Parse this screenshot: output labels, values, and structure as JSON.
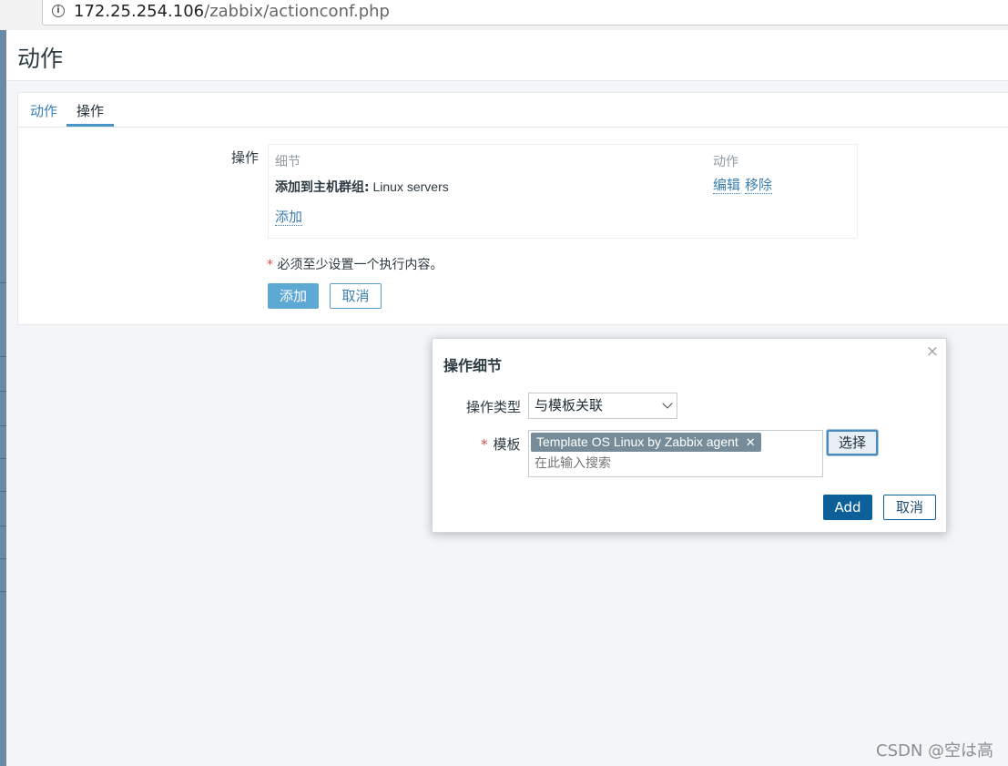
{
  "browser": {
    "url_host": "172.25.254.106",
    "url_path": "/zabbix/actionconf.php"
  },
  "page": {
    "title": "动作"
  },
  "tabs": [
    {
      "label": "动作"
    },
    {
      "label": "操作"
    }
  ],
  "operations": {
    "label": "操作",
    "col_detail": "细节",
    "col_action": "动作",
    "row": {
      "detail_bold": "添加到主机群组:",
      "detail_value": "Linux servers",
      "edit_label": "编辑",
      "remove_label": "移除"
    },
    "add_link": "添加"
  },
  "required_note": {
    "star": "*",
    "text": "必须至少设置一个执行内容。"
  },
  "form_buttons": {
    "add": "添加",
    "cancel": "取消"
  },
  "modal": {
    "title": "操作细节",
    "close_glyph": "×",
    "op_type_label": "操作类型",
    "op_type_value": "与模板关联",
    "template_label": "模板",
    "required_star": "*",
    "chip": "Template OS Linux by Zabbix agent",
    "chip_remove": "✕",
    "search_placeholder": "在此输入搜索",
    "select_button": "选择",
    "add_button": "Add",
    "cancel_button": "取消"
  },
  "watermark": "CSDN @空は高",
  "colors": {
    "link": "#3a7fb0",
    "primary_button": "#0d5f99",
    "light_primary_button": "#5ea8d4",
    "required_star": "#d64e4e"
  }
}
